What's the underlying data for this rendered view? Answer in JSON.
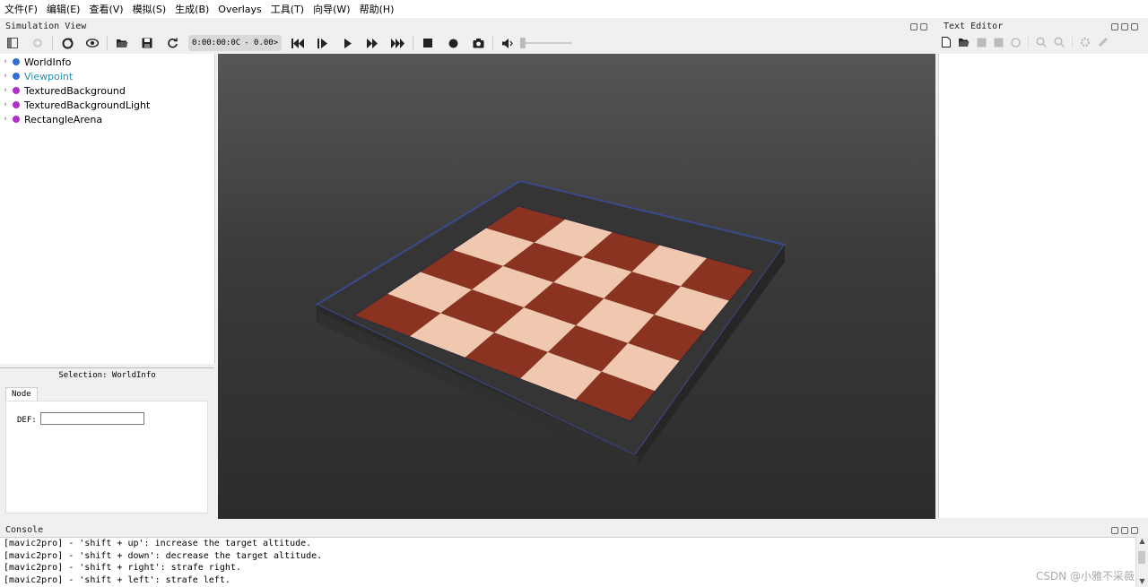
{
  "menubar": {
    "items": [
      "文件(F)",
      "编辑(E)",
      "查看(V)",
      "模拟(S)",
      "生成(B)",
      "Overlays",
      "工具(T)",
      "向导(W)",
      "帮助(H)"
    ]
  },
  "simulation_view": {
    "title": "Simulation View",
    "time": "0:00:00:0C",
    "speed": "- 0.00>"
  },
  "scene_tree": {
    "items": [
      {
        "label": "WorldInfo",
        "color": "#2f6fd6",
        "selected": false
      },
      {
        "label": "Viewpoint",
        "color": "#2f6fd6",
        "selected": true
      },
      {
        "label": "TexturedBackground",
        "color": "#b02fc8",
        "selected": false
      },
      {
        "label": "TexturedBackgroundLight",
        "color": "#b02fc8",
        "selected": false
      },
      {
        "label": "RectangleArena",
        "color": "#b02fc8",
        "selected": false
      }
    ]
  },
  "selection": {
    "title": "Selection: WorldInfo",
    "tab": "Node",
    "def_label": "DEF:",
    "def_value": ""
  },
  "text_editor": {
    "title": "Text Editor"
  },
  "console": {
    "title": "Console",
    "lines": [
      "[mavic2pro] - 'shift + up': increase the target altitude.",
      "[mavic2pro] - 'shift + down': decrease the target altitude.",
      "[mavic2pro] - 'shift + right': strafe right.",
      "[mavic2pro] - 'shift + left': strafe left."
    ]
  },
  "watermark": "CSDN @小雅不采薇",
  "colors": {
    "accent_selected": "#1a8fb0",
    "wood_dark": "#8a3320",
    "wood_light": "#f0c8b0"
  }
}
